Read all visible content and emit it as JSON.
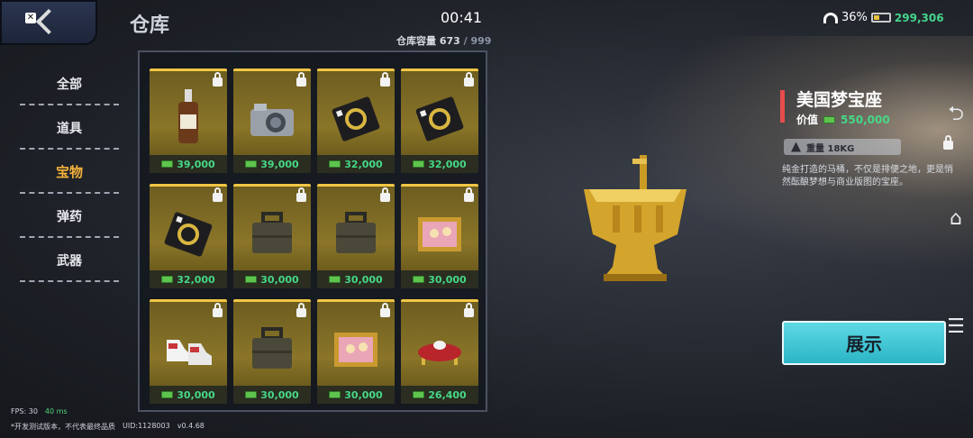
{
  "header": {
    "title": "仓库",
    "clock": "00:41",
    "capacity_label": "仓库容量",
    "capacity_used": "673",
    "capacity_max": "/ 999",
    "battery_percent": "36%",
    "money": "299,306"
  },
  "sidebar": {
    "items": [
      {
        "label": "全部"
      },
      {
        "label": "道具"
      },
      {
        "label": "宝物"
      },
      {
        "label": "弹药"
      },
      {
        "label": "武器"
      }
    ],
    "active_index": 2
  },
  "inventory": {
    "items": [
      {
        "name": "whiskey-bottle",
        "price": "39,000"
      },
      {
        "name": "camera",
        "price": "39,000"
      },
      {
        "name": "gold-card",
        "price": "32,000"
      },
      {
        "name": "gold-card",
        "price": "32,000"
      },
      {
        "name": "gold-card",
        "price": "32,000"
      },
      {
        "name": "briefcase",
        "price": "30,000"
      },
      {
        "name": "briefcase",
        "price": "30,000"
      },
      {
        "name": "framed-painting",
        "price": "30,000"
      },
      {
        "name": "sneakers",
        "price": "30,000"
      },
      {
        "name": "briefcase",
        "price": "30,000"
      },
      {
        "name": "framed-painting",
        "price": "30,000"
      },
      {
        "name": "ring-cushion",
        "price": "26,400"
      }
    ]
  },
  "detail": {
    "name": "美国梦宝座",
    "value_label": "价值",
    "value": "550,000",
    "weight": "重量 18KG",
    "description": "纯金打造的马桶，不仅是排便之地，更是悄然酝酿梦想与商业版图的宝座。",
    "show_button": "展示"
  },
  "footer": {
    "fps": "FPS: 30",
    "ping": "40 ms",
    "note": "*开发测试版本，不代表最终品质",
    "uid": "UID:1128003",
    "version": "v0.4.68"
  },
  "colors": {
    "accent_gold": "#f1c644",
    "price_green": "#46d886",
    "button_cyan": "#2bb5c6",
    "active_tab": "#f3b13b"
  }
}
